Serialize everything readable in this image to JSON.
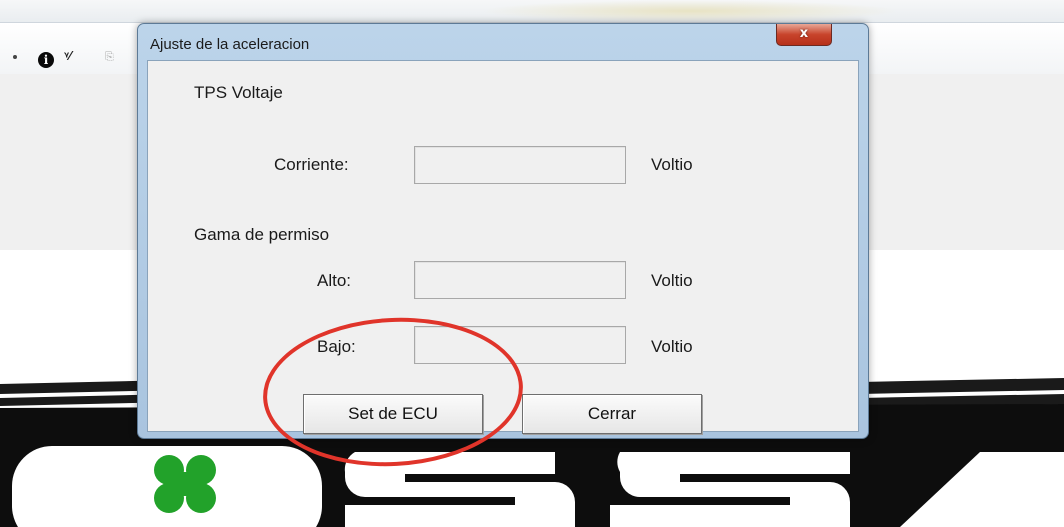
{
  "dialog": {
    "title": "Ajuste de la aceleracion",
    "close_symbol": "x",
    "tps_section_label": "TPS Voltaje",
    "current_label": "Corriente:",
    "current_value": "",
    "range_section_label": "Gama de permiso",
    "high_label": "Alto:",
    "high_value": "",
    "low_label": "Bajo:",
    "low_value": "",
    "unit_label": "Voltio",
    "set_button_label": "Set de ECU",
    "close_button_label": "Cerrar"
  },
  "toolbar": {
    "icons": [
      "info-icon",
      "tool-icon",
      "tool2-icon"
    ]
  },
  "colors": {
    "annotation_circle": "#e0342a",
    "logo_green": "#22a22a",
    "dialog_frame": "#bcd4ea"
  }
}
